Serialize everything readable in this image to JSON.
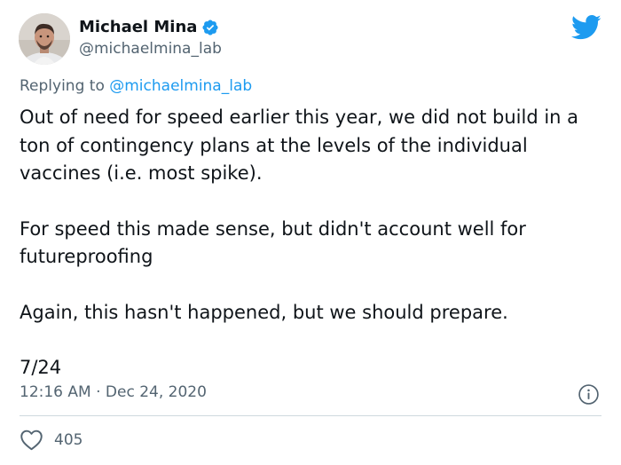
{
  "author": {
    "display_name": "Michael Mina",
    "handle": "@michaelmina_lab",
    "verified": true,
    "avatar_icon": "person-photo"
  },
  "reply": {
    "prefix": "Replying to",
    "to_handle": "@michaelmina_lab"
  },
  "tweet": {
    "paragraphs": [
      "Out of need for speed earlier this year, we did not build in a ton of contingency plans at the levels of the individual vaccines (i.e. most spike).",
      "For speed this made sense, but didn't account well for futureproofing",
      "Again, this hasn't happened, but we should prepare.",
      "7/24"
    ],
    "timestamp": "12:16 AM · Dec 24, 2020",
    "likes": "405"
  },
  "icons": {
    "brand": "twitter-bird-icon",
    "verified": "verified-badge-icon",
    "info": "info-icon",
    "like": "heart-icon"
  },
  "colors": {
    "brand_blue": "#1d9bf0",
    "secondary_text": "#536471",
    "primary_text": "#0f1419",
    "divider": "#cfd9de"
  }
}
